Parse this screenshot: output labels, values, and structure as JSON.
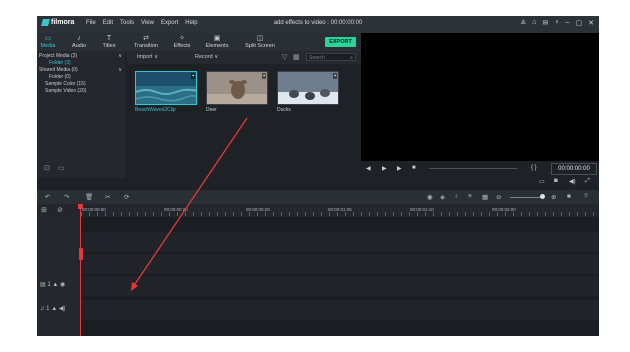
{
  "app": {
    "logo_text": "filmora",
    "window_title": "add effects to video : 00:00:00:00",
    "menu": [
      "File",
      "Edit",
      "Tools",
      "View",
      "Export",
      "Help"
    ]
  },
  "toolbar": {
    "tabs": [
      {
        "label": "Media",
        "icon": "folder-icon",
        "glyph": "▭"
      },
      {
        "label": "Audio",
        "icon": "music-note-icon",
        "glyph": "♪"
      },
      {
        "label": "Titles",
        "icon": "text-icon",
        "glyph": "T"
      },
      {
        "label": "Transition",
        "icon": "transition-icon",
        "glyph": "⇄"
      },
      {
        "label": "Effects",
        "icon": "effects-icon",
        "glyph": "✧"
      },
      {
        "label": "Elements",
        "icon": "image-icon",
        "glyph": "▣"
      },
      {
        "label": "Split Screen",
        "icon": "split-screen-icon",
        "glyph": "◫"
      }
    ],
    "active_tab": "Media",
    "export_label": "EXPORT"
  },
  "library": {
    "items": [
      {
        "label": "Project Media (3)",
        "chevron": "∨",
        "level": 0
      },
      {
        "label": "Folder (3)",
        "chevron": "",
        "level": 1,
        "selected": true
      },
      {
        "label": "Shared Media (0)",
        "chevron": "∨",
        "level": 0
      },
      {
        "label": "Folder (0)",
        "chevron": "",
        "level": 1
      },
      {
        "label": "Sample Color (15)",
        "chevron": "",
        "level": 0
      },
      {
        "label": "Sample Video (20)",
        "chevron": "",
        "level": 0
      }
    ]
  },
  "media": {
    "import_label": "Import",
    "record_label": "Record",
    "search_placeholder": "Search",
    "clips": [
      {
        "name": "BeachWaves2Clip",
        "selected": true
      },
      {
        "name": "Deer",
        "selected": false
      },
      {
        "name": "Ducks",
        "selected": false
      }
    ]
  },
  "preview": {
    "timecode": "00:00:00:00",
    "brace_text": "{ }"
  },
  "timeline": {
    "ruler_labels": [
      "00:00:00:00",
      "00:00:00:20",
      "00:00:00:20",
      "00:00:01:05",
      "00:00:01:10",
      "00:00:02:00"
    ],
    "tracks": [
      {
        "label": "▤ 1",
        "type": "video"
      },
      {
        "label": "♫ 1",
        "type": "audio"
      }
    ]
  },
  "colors": {
    "accent": "#35c6cf",
    "export_button": "#2ad49a",
    "playhead": "#e53935",
    "annotation_arrow": "#e53935"
  }
}
